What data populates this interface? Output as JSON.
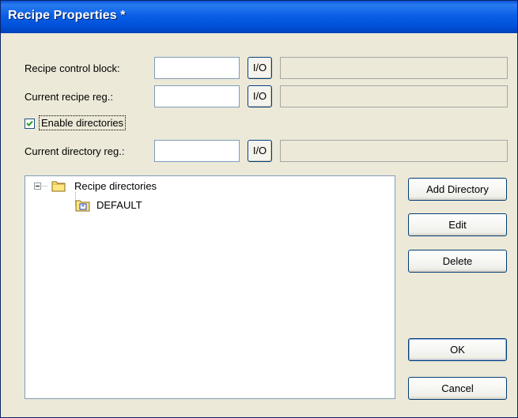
{
  "window": {
    "title": "Recipe Properties *"
  },
  "fields": {
    "recipe_control_block": {
      "label": "Recipe control block:",
      "value": "",
      "io": "I/O",
      "info": ""
    },
    "current_recipe_reg": {
      "label": "Current recipe reg.:",
      "value": "",
      "io": "I/O",
      "info": ""
    },
    "current_directory_reg": {
      "label": "Current directory reg.:",
      "value": "",
      "io": "I/O",
      "info": ""
    }
  },
  "enable_directories": {
    "label": "Enable directories",
    "checked": true
  },
  "tree": {
    "root": {
      "label": "Recipe directories",
      "expanded": true
    },
    "children": [
      {
        "label": "DEFAULT"
      }
    ]
  },
  "buttons": {
    "add_directory": "Add Directory",
    "edit": "Edit",
    "delete": "Delete",
    "ok": "OK",
    "cancel": "Cancel"
  },
  "icons": [
    "collapse-icon",
    "folder-icon",
    "default-folder-icon",
    "checkmark-icon"
  ]
}
